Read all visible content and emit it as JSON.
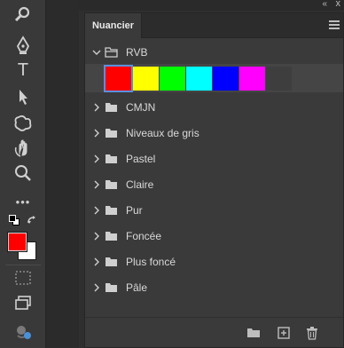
{
  "colors": {
    "panel_bg": "#3a3a3a",
    "foreground": "#ff0000",
    "background": "#ffffff"
  },
  "toolbar": {
    "icons": [
      "zoom-icon",
      "pen-icon",
      "type-icon",
      "path-selection-icon",
      "custom-shape-icon",
      "hand-rotate-icon",
      "zoom-tool-icon",
      "more-tools-icon",
      "default-colors-icon",
      "swap-colors-icon",
      "quick-mask-icon",
      "screen-mode-icon",
      "generative-icon"
    ],
    "type_label": "T",
    "more_label": "•••"
  },
  "panel": {
    "tab_label": "Nuancier",
    "collapse_label": "«",
    "close_label": "x",
    "groups": [
      {
        "label": "RVB",
        "expanded": true
      },
      {
        "label": "CMJN",
        "expanded": false
      },
      {
        "label": "Niveaux de gris",
        "expanded": false
      },
      {
        "label": "Pastel",
        "expanded": false
      },
      {
        "label": "Claire",
        "expanded": false
      },
      {
        "label": "Pur",
        "expanded": false
      },
      {
        "label": "Foncée",
        "expanded": false
      },
      {
        "label": "Plus foncé",
        "expanded": false
      },
      {
        "label": "Pâle",
        "expanded": false
      }
    ],
    "swatches": [
      {
        "color": "#ff0000",
        "name": "rouge",
        "selected": true
      },
      {
        "color": "#ffff00",
        "name": "jaune"
      },
      {
        "color": "#00ff00",
        "name": "vert"
      },
      {
        "color": "#00ffff",
        "name": "cyan"
      },
      {
        "color": "#0000ff",
        "name": "bleu"
      },
      {
        "color": "#ff00ff",
        "name": "magenta"
      }
    ],
    "footer_icons": [
      "new-group-icon",
      "new-swatch-icon",
      "delete-icon"
    ]
  }
}
